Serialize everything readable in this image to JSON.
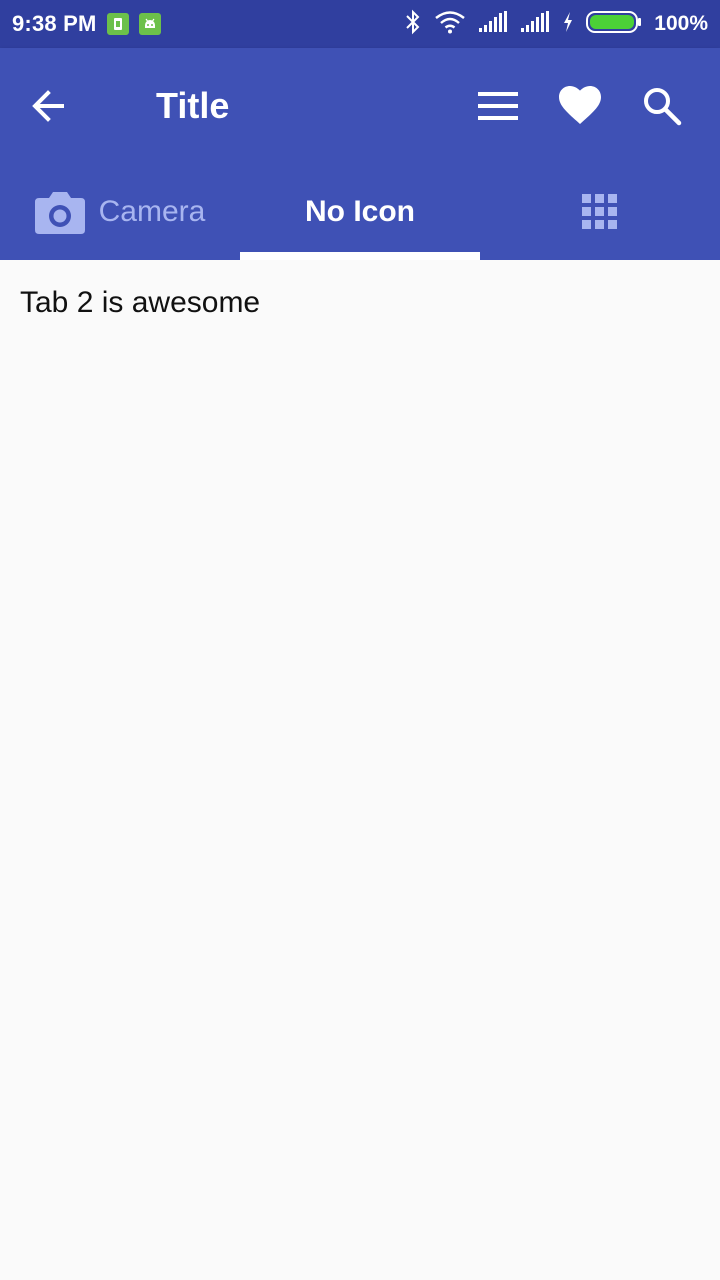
{
  "status_bar": {
    "time": "9:38 PM",
    "battery_percent": "100%",
    "icons": [
      "sim-card-icon",
      "android-icon",
      "bluetooth-icon",
      "wifi-icon",
      "signal-icon",
      "signal-icon",
      "charging-icon",
      "battery-icon"
    ]
  },
  "toolbar": {
    "title": "Title",
    "icons": [
      "back-arrow-icon",
      "menu-icon",
      "heart-icon",
      "search-icon"
    ]
  },
  "tabs": [
    {
      "label": "Camera",
      "icon": "camera-icon",
      "selected": false
    },
    {
      "label": "No Icon",
      "icon": "",
      "selected": true
    },
    {
      "label": "",
      "icon": "apps-grid-icon",
      "selected": false
    }
  ],
  "content": {
    "text": "Tab 2 is awesome"
  },
  "colors": {
    "status_bar": "#303f9f",
    "primary": "#3f51b5",
    "background": "#fafafa",
    "tab_inactive": "#a8b5f0",
    "battery_fill": "#4cd137"
  }
}
